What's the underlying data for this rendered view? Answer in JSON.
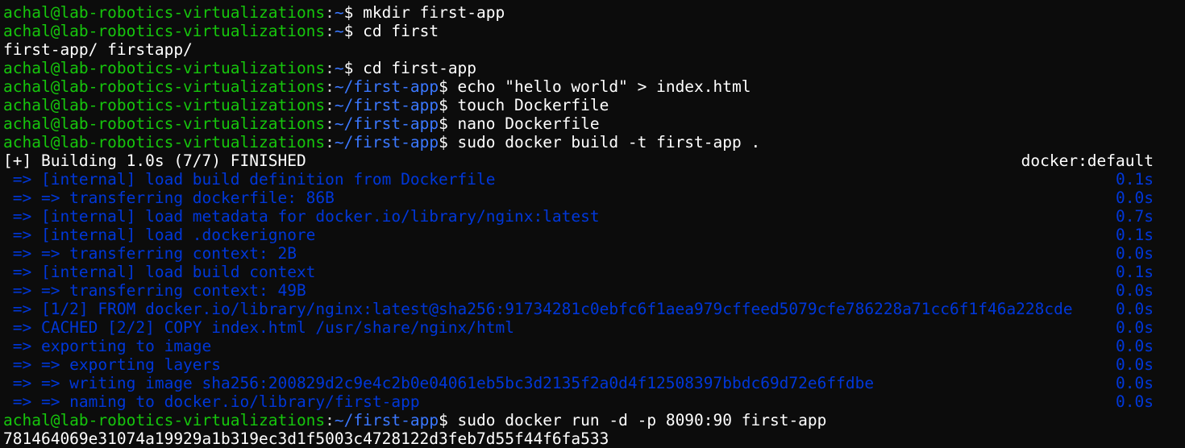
{
  "prompt": {
    "user_host": "achal@lab-robotics-virtualizations",
    "colon": ":",
    "home_path": "~",
    "app_path": "~/first-app",
    "symbol": "$ "
  },
  "session": [
    {
      "kind": "prompt",
      "path": "home",
      "command": "mkdir first-app"
    },
    {
      "kind": "prompt",
      "path": "home",
      "command": "cd first"
    },
    {
      "kind": "output",
      "text": "first-app/ firstapp/"
    },
    {
      "kind": "prompt",
      "path": "home",
      "command": "cd first-app"
    },
    {
      "kind": "prompt",
      "path": "app",
      "command": "echo \"hello world\" > index.html"
    },
    {
      "kind": "prompt",
      "path": "app",
      "command": "touch Dockerfile"
    },
    {
      "kind": "prompt",
      "path": "app",
      "command": "nano Dockerfile"
    },
    {
      "kind": "prompt",
      "path": "app",
      "command": "sudo docker build -t first-app ."
    }
  ],
  "build": {
    "header": "[+] Building 1.0s (7/7) FINISHED",
    "context": "docker:default",
    "steps": [
      {
        "text": " => [internal] load build definition from Dockerfile",
        "time": "0.1s"
      },
      {
        "text": " => => transferring dockerfile: 86B",
        "time": "0.0s"
      },
      {
        "text": " => [internal] load metadata for docker.io/library/nginx:latest",
        "time": "0.7s"
      },
      {
        "text": " => [internal] load .dockerignore",
        "time": "0.1s"
      },
      {
        "text": " => => transferring context: 2B",
        "time": "0.0s"
      },
      {
        "text": " => [internal] load build context",
        "time": "0.1s"
      },
      {
        "text": " => => transferring context: 49B",
        "time": "0.0s"
      },
      {
        "text": " => [1/2] FROM docker.io/library/nginx:latest@sha256:91734281c0ebfc6f1aea979cffeed5079cfe786228a71cc6f1f46a228cde",
        "time": "0.0s"
      },
      {
        "text": " => CACHED [2/2] COPY index.html /usr/share/nginx/html",
        "time": "0.0s"
      },
      {
        "text": " => exporting to image",
        "time": "0.0s"
      },
      {
        "text": " => => exporting layers",
        "time": "0.0s"
      },
      {
        "text": " => => writing image sha256:200829d2c9e4c2b0e04061eb5bc3d2135f2a0d4f12508397bbdc69d72e6ffdbe",
        "time": "0.0s"
      },
      {
        "text": " => => naming to docker.io/library/first-app",
        "time": "0.0s"
      }
    ]
  },
  "after": [
    {
      "kind": "prompt",
      "path": "app",
      "command": "sudo docker run -d -p 8090:90 first-app"
    },
    {
      "kind": "output",
      "text": "781464069e31074a19929a1b319ec3d1f5003c4728122d3feb7d55f44f6fa533"
    }
  ],
  "colors": {
    "background": "#0c0c0c",
    "user_host": "#16c60c",
    "path": "#3b78ff",
    "build_steps": "#0037da",
    "text": "#ffffff"
  }
}
